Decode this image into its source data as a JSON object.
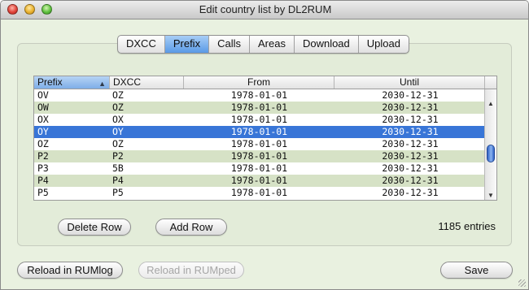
{
  "window": {
    "title": "Edit country list by DL2RUM"
  },
  "tabs": [
    {
      "label": "DXCC",
      "active": false
    },
    {
      "label": "Prefix",
      "active": true
    },
    {
      "label": "Calls",
      "active": false
    },
    {
      "label": "Areas",
      "active": false
    },
    {
      "label": "Download",
      "active": false
    },
    {
      "label": "Upload",
      "active": false
    }
  ],
  "table": {
    "columns": [
      "Prefix",
      "DXCC",
      "From",
      "Until"
    ],
    "sorted_column": "Prefix",
    "sort_direction": "ascending",
    "rows": [
      [
        "OV",
        "OZ",
        "1978-01-01",
        "2030-12-31"
      ],
      [
        "OW",
        "OZ",
        "1978-01-01",
        "2030-12-31"
      ],
      [
        "OX",
        "OX",
        "1978-01-01",
        "2030-12-31"
      ],
      [
        "OY",
        "OY",
        "1978-01-01",
        "2030-12-31"
      ],
      [
        "OZ",
        "OZ",
        "1978-01-01",
        "2030-12-31"
      ],
      [
        "P2",
        "P2",
        "1978-01-01",
        "2030-12-31"
      ],
      [
        "P3",
        "5B",
        "1978-01-01",
        "2030-12-31"
      ],
      [
        "P4",
        "P4",
        "1978-01-01",
        "2030-12-31"
      ],
      [
        "P5",
        "P5",
        "1978-01-01",
        "2030-12-31"
      ]
    ],
    "selected_row": 3,
    "scroll_position": 0.52
  },
  "buttons": {
    "delete_row": "Delete Row",
    "add_row": "Add Row",
    "reload_rumlog": "Reload in RUMlog",
    "reload_rumped": "Reload in RUMped",
    "save": "Save"
  },
  "status": {
    "entries": "1185 entries"
  },
  "colors": {
    "selection": "#3875d7",
    "row_alt": "#d6e2c6",
    "window_bg": "#e9f1e0"
  }
}
